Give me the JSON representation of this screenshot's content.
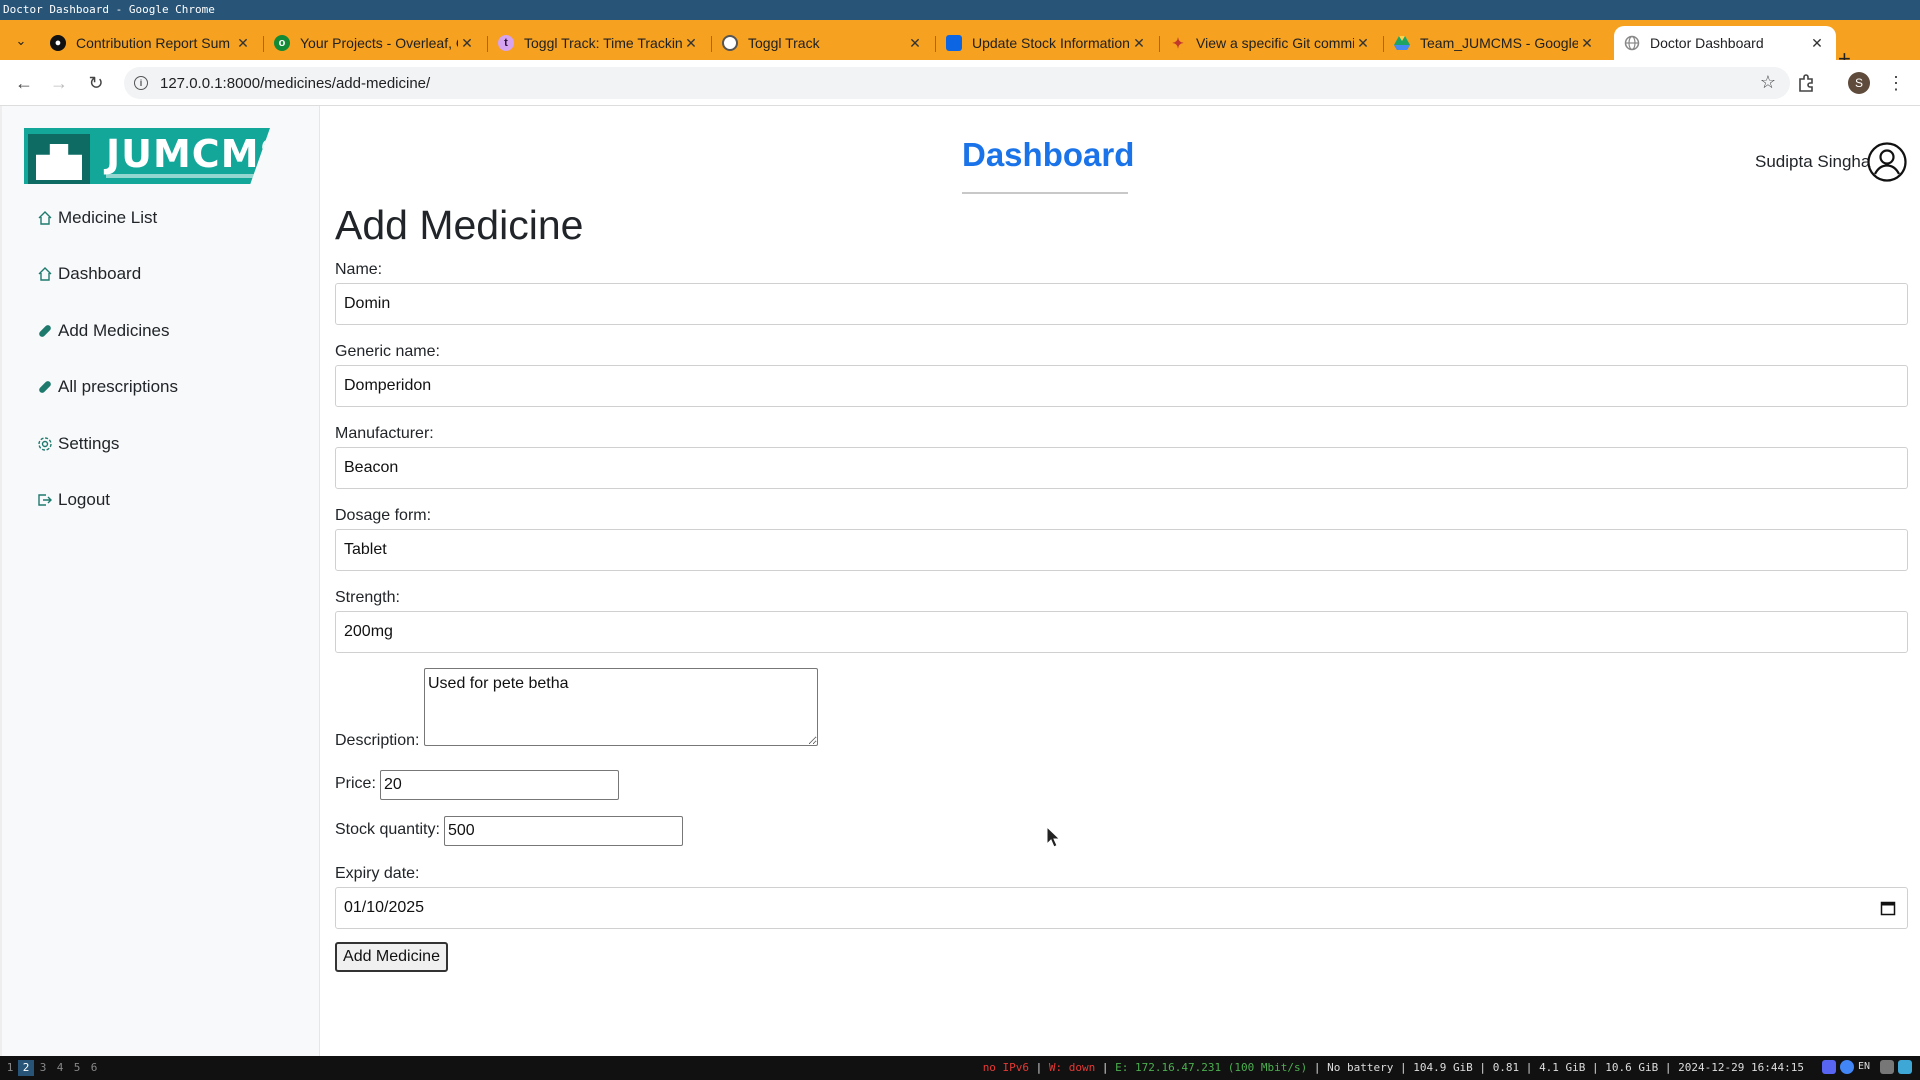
{
  "window": {
    "title": "Doctor Dashboard - Google Chrome"
  },
  "tabs": [
    {
      "title": "Contribution Report Sum",
      "icon": "github-icon"
    },
    {
      "title": "Your Projects - Overleaf, O",
      "icon": "overleaf-icon"
    },
    {
      "title": "Toggl Track: Time Tracking",
      "icon": "toggl-icon"
    },
    {
      "title": "Toggl Track",
      "icon": "toggl-icon"
    },
    {
      "title": "Update Stock Information",
      "icon": "trello-icon"
    },
    {
      "title": "View a specific Git commit",
      "icon": "git-icon"
    },
    {
      "title": "Team_JUMCMS - Google D",
      "icon": "drive-icon"
    },
    {
      "title": "Doctor Dashboard",
      "icon": "globe-icon",
      "active": true
    }
  ],
  "browser": {
    "url": "127.0.0.1:8000/medicines/add-medicine/",
    "profile_initial": "S"
  },
  "app": {
    "logo_text": "JUMCMS",
    "header_title": "Dashboard",
    "user_name": "Sudipta Singha"
  },
  "sidebar": {
    "items": [
      {
        "label": "Medicine List",
        "icon": "home-icon"
      },
      {
        "label": "Dashboard",
        "icon": "home-icon"
      },
      {
        "label": "Add Medicines",
        "icon": "capsule-icon"
      },
      {
        "label": "All prescriptions",
        "icon": "capsule-icon"
      },
      {
        "label": "Settings",
        "icon": "gear-icon"
      },
      {
        "label": "Logout",
        "icon": "logout-icon"
      }
    ]
  },
  "form": {
    "title": "Add Medicine",
    "name_label": "Name:",
    "name_value": "Domin",
    "generic_label": "Generic name:",
    "generic_value": "Domperidon",
    "manufacturer_label": "Manufacturer:",
    "manufacturer_value": "Beacon",
    "dosage_label": "Dosage form:",
    "dosage_value": "Tablet",
    "strength_label": "Strength:",
    "strength_value": "200mg",
    "description_label": "Description:",
    "description_value": "Used for pete betha",
    "price_label": "Price:",
    "price_value": "20",
    "stock_label": "Stock quantity:",
    "stock_value": "500",
    "expiry_label": "Expiry date:",
    "expiry_value": "01/10/2025",
    "submit_label": "Add Medicine"
  },
  "statusbar": {
    "workspaces": [
      "1",
      "2",
      "3",
      "4",
      "5",
      "6"
    ],
    "active_workspace": "2",
    "ipv6": "no IPv6",
    "wifi": "W: down",
    "ethernet": "E: 172.16.47.231 (100 Mbit/s)",
    "battery": "No battery",
    "disk": "104.9 GiB",
    "load": "0.81",
    "memory": "4.1 GiB | 10.6 GiB",
    "datetime": "2024-12-29 16:44:15",
    "lang": "EN"
  },
  "colors": {
    "tabstrip": "#f6a11f",
    "accent": "#1a73e8",
    "logo": "#13a79a",
    "sidebar_icon": "#1f7a6e"
  }
}
